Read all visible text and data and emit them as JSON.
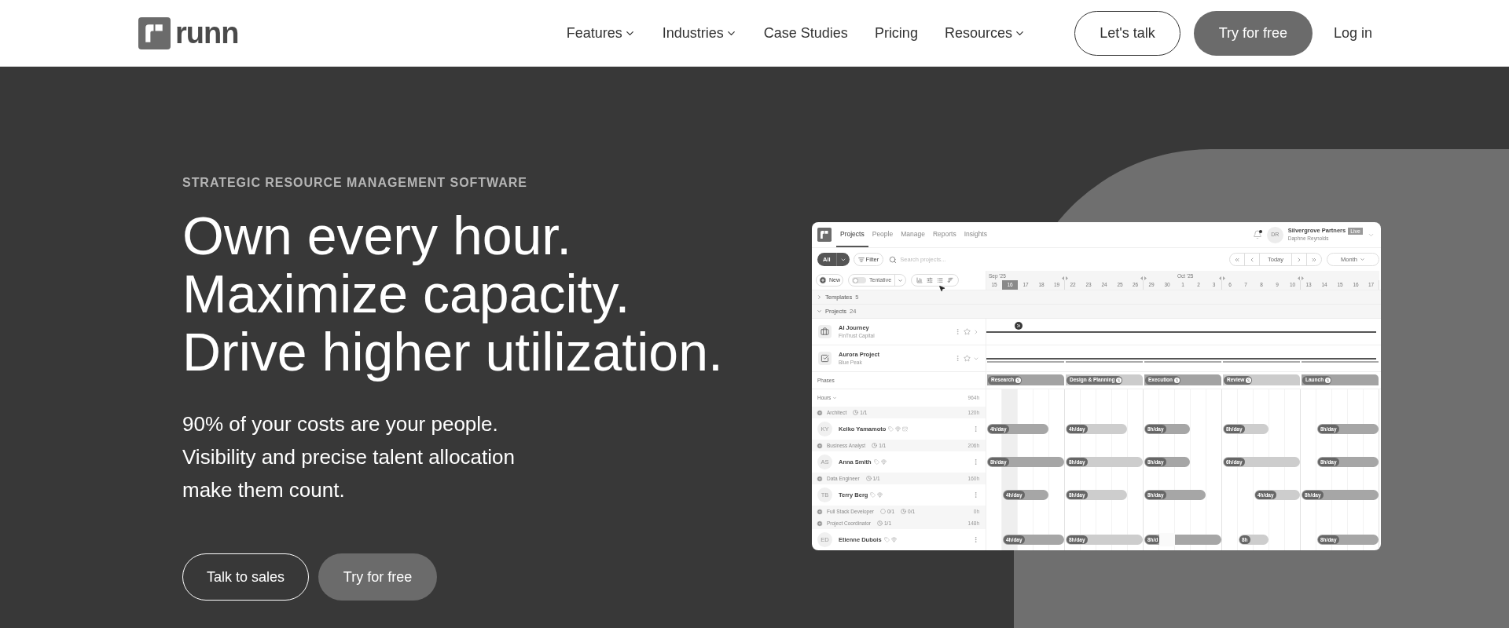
{
  "nav": {
    "logo": "runn",
    "links": [
      {
        "label": "Features",
        "dropdown": true
      },
      {
        "label": "Industries",
        "dropdown": true
      },
      {
        "label": "Case Studies",
        "dropdown": false
      },
      {
        "label": "Pricing",
        "dropdown": false
      },
      {
        "label": "Resources",
        "dropdown": true
      }
    ],
    "buttons": [
      {
        "label": "Let's talk",
        "kind": "outline"
      },
      {
        "label": "Try for free",
        "kind": "filled"
      }
    ],
    "login": "Log in"
  },
  "hero": {
    "eyebrow": "STRATEGIC RESOURCE MANAGEMENT SOFTWARE",
    "headline": [
      "Own every hour.",
      "Maximize capacity.",
      "Drive higher utilization."
    ],
    "body": [
      "90% of your costs are your people.",
      "Visibility and precise talent allocation",
      "make them count."
    ],
    "buttons": [
      {
        "label": "Talk to sales",
        "kind": "outline"
      },
      {
        "label": "Try for free",
        "kind": "filled"
      }
    ]
  },
  "app": {
    "tabs": [
      {
        "label": "Projects",
        "selected": true
      },
      {
        "label": "People",
        "selected": false
      },
      {
        "label": "Manage",
        "selected": false
      },
      {
        "label": "Reports",
        "selected": false
      },
      {
        "label": "Insights",
        "selected": false
      }
    ],
    "account": {
      "initials": "DR",
      "company": "Silvergrove Partners",
      "badge": "Live",
      "user": "Daphne Reynolds",
      "notification": true
    },
    "filters": {
      "scope": "All",
      "filter": "Filter",
      "search_placeholder": "Search projects..."
    },
    "navigation": {
      "today": "Today",
      "period": "Month"
    },
    "toolbar": {
      "new": "New",
      "tentative": {
        "label": "Tentative",
        "on": false
      }
    },
    "timeline": {
      "months": [
        "Sep '25",
        "Oct '25"
      ],
      "weeks": [
        {
          "days": [
            {
              "label": "15",
              "selected": false
            },
            {
              "label": "16",
              "selected": true
            },
            {
              "label": "17",
              "selected": false
            },
            {
              "label": "18",
              "selected": false
            },
            {
              "label": "19",
              "selected": false
            }
          ]
        },
        {
          "days": [
            {
              "label": "22",
              "selected": false
            },
            {
              "label": "23",
              "selected": false
            },
            {
              "label": "24",
              "selected": false
            },
            {
              "label": "25",
              "selected": false
            },
            {
              "label": "26",
              "selected": false
            }
          ]
        },
        {
          "days": [
            {
              "label": "29",
              "selected": false
            },
            {
              "label": "30",
              "selected": false
            },
            {
              "label": "1",
              "selected": false
            },
            {
              "label": "2",
              "selected": false
            },
            {
              "label": "3",
              "selected": false
            }
          ]
        },
        {
          "days": [
            {
              "label": "6",
              "selected": false
            },
            {
              "label": "7",
              "selected": false
            },
            {
              "label": "8",
              "selected": false
            },
            {
              "label": "9",
              "selected": false
            },
            {
              "label": "10",
              "selected": false
            }
          ]
        },
        {
          "days": [
            {
              "label": "13",
              "selected": false
            },
            {
              "label": "14",
              "selected": false
            },
            {
              "label": "15",
              "selected": false
            },
            {
              "label": "16",
              "selected": false
            },
            {
              "label": "17",
              "selected": false
            }
          ]
        }
      ]
    },
    "groups": [
      {
        "label": "Templates",
        "count": "5",
        "expanded": false
      },
      {
        "label": "Projects",
        "count": "24",
        "expanded": true
      }
    ],
    "projects": [
      {
        "name": "AI Journey",
        "client": "FinTrust Capital",
        "expanded": false
      },
      {
        "name": "Aurora Project",
        "client": "Blue Peak",
        "expanded": true
      }
    ],
    "phases": {
      "label": "Phases",
      "items": [
        {
          "name": "Research",
          "tentative": false
        },
        {
          "name": "Design & Planning",
          "tentative": true
        },
        {
          "name": "Execution",
          "tentative": false
        },
        {
          "name": "Review",
          "tentative": true
        },
        {
          "name": "Launch",
          "tentative": false
        }
      ]
    },
    "hours": {
      "label": "Hours",
      "total": "964h"
    },
    "roles": [
      {
        "name": "Architect",
        "counts": [
          {
            "kind": "assigned",
            "text": "1/1"
          }
        ],
        "hours": "120h",
        "people": [
          {
            "initials": "KY",
            "name": "Keiko Yamamoto",
            "flags": [
              {
                "kind": "tag"
              },
              {
                "kind": "skill"
              },
              {
                "kind": "note"
              }
            ],
            "bars": [
              {
                "label": "4h/day",
                "tentative": false
              },
              {
                "label": "4h/day",
                "tentative": true
              },
              {
                "label": "8h/day",
                "tentative": false
              },
              {
                "label": "8h/day",
                "tentative": true
              },
              {
                "label": "8h/day",
                "tentative": false
              }
            ]
          }
        ]
      },
      {
        "name": "Business Analyst",
        "counts": [
          {
            "kind": "assigned",
            "text": "1/1"
          }
        ],
        "hours": "206h",
        "people": [
          {
            "initials": "AS",
            "name": "Anna Smith",
            "flags": [
              {
                "kind": "tag"
              },
              {
                "kind": "skill"
              }
            ],
            "bars": [
              {
                "label": "8h/day",
                "tentative": false
              },
              {
                "label": "8h/day",
                "tentative": true
              },
              {
                "label": "8h/day",
                "tentative": false
              },
              {
                "label": "6h/day",
                "tentative": true
              },
              {
                "label": "8h/day",
                "tentative": false
              }
            ]
          }
        ]
      },
      {
        "name": "Data Engineer",
        "counts": [
          {
            "kind": "assigned",
            "text": "1/1"
          }
        ],
        "hours": "160h",
        "people": [
          {
            "initials": "TB",
            "name": "Terry Berg",
            "flags": [
              {
                "kind": "tag"
              },
              {
                "kind": "skill"
              }
            ],
            "bars": [
              {
                "label": "4h/day",
                "tentative": false
              },
              {
                "label": "8h/day",
                "tentative": true
              },
              {
                "label": "8h/day",
                "tentative": false
              },
              {
                "label": "4h/day",
                "tentative": true
              },
              {
                "label": "8h/day",
                "tentative": false
              }
            ]
          }
        ]
      },
      {
        "name": "Full Stack Developer",
        "counts": [
          {
            "kind": "pending",
            "text": "0/1"
          },
          {
            "kind": "assigned",
            "text": "0/1"
          }
        ],
        "hours": "0h"
      },
      {
        "name": "Project Coordinator",
        "counts": [
          {
            "kind": "assigned",
            "text": "1/1"
          }
        ],
        "hours": "148h",
        "people": [
          {
            "initials": "ED",
            "name": "Etienne Dubois",
            "flags": [
              {
                "kind": "tag"
              },
              {
                "kind": "skill"
              }
            ],
            "bars": [
              {
                "label": "4h/day",
                "tentative": false
              },
              {
                "label": "8h/day",
                "tentative": true
              },
              {
                "label": "8h/d",
                "tentative": false
              },
              {
                "label": "8h",
                "tentative": true
              },
              {
                "label": "8h/day",
                "tentative": false
              }
            ]
          }
        ]
      }
    ]
  }
}
